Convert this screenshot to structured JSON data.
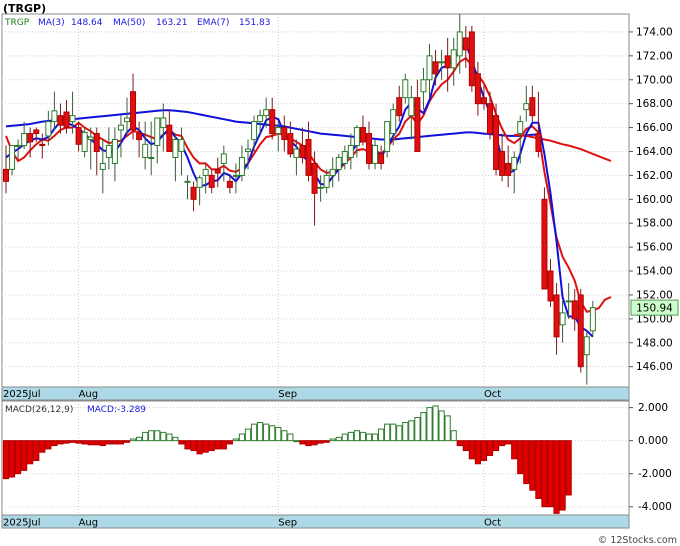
{
  "title": "(TRGP)",
  "legend": {
    "symbol": "TRGP",
    "items": [
      {
        "label": "MA(3)",
        "value": "148.64",
        "color": "#1a1adf"
      },
      {
        "label": "MA(50)",
        "value": "163.21",
        "color": "#1a1adf"
      },
      {
        "label": "EMA(7)",
        "value": "151.83",
        "color": "#1a1adf"
      }
    ]
  },
  "macd_legend": {
    "label": "MACD(26,12,9)",
    "value_label": "MACD:-3.289"
  },
  "last_price_label": "150.94",
  "watermark": "© 12Stocks.com",
  "colors": {
    "up": "#2e7d2e",
    "down": "#e01010",
    "ma_fast": "#1010dd",
    "ma_slow": "#e01010",
    "ema": "#e01010",
    "axis_band": "#add8e6",
    "price_tag": "#ccffcc"
  },
  "chart_data": [
    {
      "type": "candlestick",
      "title": "(TRGP)",
      "x_tick_labels": [
        {
          "label": "2025Jul",
          "index": 0
        },
        {
          "label": "Aug",
          "index": 12
        },
        {
          "label": "Sep",
          "index": 45
        },
        {
          "label": "Oct",
          "index": 79
        }
      ],
      "y_tick_labels": [
        "146.00",
        "148.00",
        "150.00",
        "152.00",
        "154.00",
        "156.00",
        "158.00",
        "160.00",
        "162.00",
        "164.00",
        "166.00",
        "168.00",
        "170.00",
        "172.00",
        "174.00"
      ],
      "ylim": [
        144.3,
        175.5
      ],
      "candles": [
        [
          162.5,
          164.5,
          160.5,
          161.5
        ],
        [
          162.5,
          164.5,
          162.0,
          164.5
        ],
        [
          164.5,
          165.0,
          163.3,
          164.5
        ],
        [
          164.5,
          166.5,
          164.2,
          165.5
        ],
        [
          165.5,
          166.0,
          163.5,
          164.8
        ],
        [
          165.8,
          166.0,
          164.8,
          165.5
        ],
        [
          164.6,
          165.5,
          163.4,
          164.5
        ],
        [
          165.3,
          167.4,
          164.5,
          166.5
        ],
        [
          166.5,
          169.0,
          165.8,
          167.4
        ],
        [
          167.0,
          168.0,
          165.5,
          166.2
        ],
        [
          167.3,
          168.3,
          165.5,
          166.0
        ],
        [
          166.5,
          169.0,
          165.5,
          167.0
        ],
        [
          166.0,
          166.5,
          164.0,
          164.6
        ],
        [
          164.0,
          166.0,
          163.5,
          165.6
        ],
        [
          165.0,
          166.0,
          162.5,
          165.2
        ],
        [
          165.5,
          166.0,
          162.0,
          164.0
        ],
        [
          162.5,
          165.0,
          160.5,
          163.0
        ],
        [
          163.5,
          166.0,
          162.5,
          164.5
        ],
        [
          163.0,
          166.0,
          161.5,
          165.0
        ],
        [
          165.8,
          167.0,
          163.5,
          166.2
        ],
        [
          166.5,
          168.5,
          165.5,
          166.8
        ],
        [
          169.0,
          170.5,
          165.0,
          165.8
        ],
        [
          165.5,
          166.5,
          163.5,
          165.0
        ],
        [
          163.5,
          166.5,
          162.5,
          164.6
        ],
        [
          163.5,
          166.5,
          162.0,
          163.5
        ],
        [
          164.5,
          166.5,
          163.0,
          166.8
        ],
        [
          166.0,
          168.0,
          164.0,
          166.8
        ],
        [
          166.2,
          167.5,
          164.0,
          164.0
        ],
        [
          163.5,
          165.5,
          161.5,
          165.0
        ],
        [
          164.0,
          166.0,
          162.0,
          165.0
        ],
        [
          161.5,
          162.0,
          160.0,
          161.5
        ],
        [
          161.0,
          161.5,
          159.0,
          160.0
        ],
        [
          161.0,
          162.0,
          159.5,
          161.8
        ],
        [
          162.0,
          163.0,
          160.5,
          162.5
        ],
        [
          162.0,
          162.5,
          160.5,
          161.0
        ],
        [
          162.5,
          163.5,
          161.0,
          162.2
        ],
        [
          163.0,
          164.5,
          161.5,
          163.8
        ],
        [
          161.5,
          162.0,
          160.5,
          161.0
        ],
        [
          162.0,
          163.0,
          160.5,
          162.0
        ],
        [
          162.0,
          164.5,
          161.5,
          163.5
        ],
        [
          164.0,
          165.0,
          162.5,
          164.2
        ],
        [
          165.0,
          167.0,
          164.0,
          166.5
        ],
        [
          166.5,
          167.5,
          165.5,
          167.0
        ],
        [
          167.0,
          168.5,
          166.0,
          167.5
        ],
        [
          167.5,
          168.5,
          165.0,
          165.5
        ],
        [
          165.5,
          166.5,
          164.0,
          166.0
        ],
        [
          166.0,
          167.0,
          164.0,
          165.0
        ],
        [
          165.5,
          166.5,
          163.5,
          163.8
        ],
        [
          163.5,
          165.0,
          162.0,
          164.2
        ],
        [
          164.5,
          166.0,
          163.0,
          163.5
        ],
        [
          165.0,
          166.5,
          161.5,
          162.0
        ],
        [
          163.0,
          164.0,
          157.8,
          160.5
        ],
        [
          161.0,
          162.0,
          159.8,
          161.0
        ],
        [
          161.0,
          162.5,
          160.5,
          162.0
        ],
        [
          162.0,
          163.5,
          161.0,
          162.5
        ],
        [
          162.5,
          163.8,
          161.5,
          163.5
        ],
        [
          163.0,
          164.5,
          162.5,
          164.0
        ],
        [
          163.5,
          165.5,
          162.5,
          164.5
        ],
        [
          164.5,
          166.2,
          163.5,
          166.0
        ],
        [
          166.0,
          167.0,
          164.5,
          164.8
        ],
        [
          165.5,
          166.5,
          162.5,
          163.0
        ],
        [
          163.0,
          165.0,
          162.5,
          164.5
        ],
        [
          163.8,
          164.5,
          162.5,
          163.0
        ],
        [
          164.0,
          166.5,
          163.5,
          166.5
        ],
        [
          165.5,
          168.0,
          164.5,
          167.5
        ],
        [
          168.5,
          169.5,
          166.5,
          167.0
        ],
        [
          168.5,
          170.5,
          168.0,
          170.0
        ],
        [
          167.0,
          169.5,
          165.0,
          168.5
        ],
        [
          168.5,
          170.0,
          164.0,
          164.0
        ],
        [
          169.0,
          171.0,
          167.5,
          170.0
        ],
        [
          170.0,
          173.0,
          168.5,
          172.0
        ],
        [
          171.5,
          172.5,
          169.5,
          170.5
        ],
        [
          171.5,
          172.5,
          170.0,
          171.5
        ],
        [
          172.0,
          173.5,
          169.0,
          171.0
        ],
        [
          171.0,
          173.5,
          169.5,
          172.5
        ],
        [
          172.0,
          175.5,
          170.5,
          174.0
        ],
        [
          173.5,
          174.5,
          171.0,
          172.5
        ],
        [
          174.0,
          174.5,
          169.0,
          169.5
        ],
        [
          170.5,
          171.5,
          167.0,
          168.0
        ],
        [
          168.5,
          169.5,
          167.5,
          168.0
        ],
        [
          168.0,
          169.0,
          165.0,
          165.5
        ],
        [
          167.0,
          168.0,
          162.0,
          162.5
        ],
        [
          164.0,
          165.5,
          161.5,
          162.0
        ],
        [
          163.0,
          164.5,
          161.0,
          162.0
        ],
        [
          162.5,
          164.0,
          160.5,
          163.5
        ],
        [
          165.5,
          167.0,
          163.0,
          166.5
        ],
        [
          167.5,
          169.5,
          166.5,
          168.0
        ],
        [
          168.5,
          169.5,
          166.5,
          167.0
        ],
        [
          165.5,
          169.0,
          163.5,
          164.0
        ],
        [
          160.0,
          161.0,
          152.5,
          152.5
        ],
        [
          154.0,
          155.0,
          151.0,
          151.5
        ],
        [
          152.0,
          153.0,
          147.0,
          148.5
        ],
        [
          149.5,
          151.5,
          148.0,
          150.5
        ],
        [
          151.5,
          153.0,
          150.0,
          151.5
        ],
        [
          151.5,
          152.5,
          149.0,
          150.0
        ],
        [
          152.0,
          152.5,
          145.5,
          146.0
        ],
        [
          147.0,
          149.0,
          144.5,
          148.5
        ],
        [
          149.0,
          151.5,
          148.5,
          150.94
        ]
      ],
      "series": [
        {
          "name": "MA(3)",
          "color": "#1010dd",
          "values": [
            163.5,
            163.9,
            164.2,
            164.6,
            164.9,
            165.1,
            165.0,
            165.2,
            165.9,
            166.5,
            166.4,
            166.2,
            165.9,
            165.5,
            165.0,
            164.6,
            164.1,
            164.0,
            164.0,
            164.7,
            165.6,
            166.1,
            165.8,
            165.1,
            164.6,
            164.8,
            165.4,
            165.9,
            165.2,
            164.6,
            163.5,
            162.2,
            161.1,
            161.2,
            161.5,
            161.6,
            162.2,
            162.0,
            161.5,
            162.2,
            163.0,
            164.4,
            165.5,
            166.6,
            166.9,
            166.7,
            165.5,
            164.9,
            164.4,
            163.6,
            163.2,
            162.1,
            161.3,
            161.2,
            161.9,
            162.5,
            163.2,
            163.9,
            164.6,
            165.0,
            164.8,
            164.2,
            163.6,
            164.3,
            165.3,
            166.1,
            167.5,
            168.1,
            167.6,
            167.2,
            168.3,
            170.2,
            171.0,
            171.2,
            171.7,
            172.5,
            173.0,
            171.7,
            170.0,
            168.5,
            167.2,
            165.3,
            163.3,
            162.2,
            162.4,
            163.8,
            165.5,
            166.4,
            166.4,
            163.8,
            160.5,
            156.5,
            151.8,
            150.2,
            150.2,
            149.3,
            149.0,
            148.5
          ]
        },
        {
          "name": "MA(50)",
          "color": "#1010dd",
          "values": [
            166.1,
            166.15,
            166.2,
            166.25,
            166.3,
            166.4,
            166.5,
            166.55,
            166.6,
            166.65,
            166.7,
            166.7,
            166.75,
            166.8,
            166.85,
            166.9,
            166.95,
            167.0,
            167.05,
            167.1,
            167.15,
            167.2,
            167.25,
            167.3,
            167.35,
            167.4,
            167.45,
            167.45,
            167.4,
            167.35,
            167.3,
            167.2,
            167.1,
            167.0,
            166.9,
            166.8,
            166.7,
            166.6,
            166.5,
            166.45,
            166.4,
            166.35,
            166.3,
            166.25,
            166.2,
            166.15,
            166.1,
            166.0,
            165.9,
            165.8,
            165.7,
            165.6,
            165.5,
            165.45,
            165.4,
            165.35,
            165.3,
            165.25,
            165.2,
            165.15,
            165.1,
            165.05,
            165.0,
            165.0,
            165.0,
            165.05,
            165.1,
            165.15,
            165.2,
            165.25,
            165.3,
            165.35,
            165.4,
            165.45,
            165.5,
            165.55,
            165.6,
            165.6,
            165.55,
            165.5,
            165.45,
            165.4,
            165.35,
            165.3,
            165.3,
            165.3,
            165.35,
            165.4,
            165.4
          ]
        },
        {
          "name": "EMA(7)",
          "color": "#e01010",
          "values": [
            165.3,
            164.0,
            163.2,
            163.5,
            164.1,
            164.6,
            165.0,
            164.9,
            165.3,
            165.8,
            166.0,
            166.0,
            166.4,
            166.0,
            165.7,
            165.3,
            165.0,
            164.7,
            164.8,
            164.9,
            165.3,
            165.7,
            165.6,
            165.4,
            165.2,
            165.0,
            165.4,
            165.8,
            165.4,
            165.3,
            164.3,
            163.5,
            163.0,
            163.0,
            162.5,
            162.5,
            162.8,
            162.4,
            162.3,
            162.6,
            163.0,
            163.8,
            164.6,
            165.2,
            165.3,
            165.5,
            165.4,
            165.1,
            164.8,
            164.5,
            163.9,
            163.1,
            162.5,
            162.2,
            162.3,
            162.5,
            163.0,
            163.5,
            164.1,
            164.2,
            164.0,
            164.1,
            163.8,
            164.3,
            165.0,
            165.5,
            166.5,
            167.0,
            166.3,
            167.0,
            168.2,
            169.0,
            169.6,
            170.0,
            170.7,
            171.5,
            171.8,
            171.2,
            170.4,
            169.7,
            168.6,
            167.1,
            165.9,
            165.0,
            164.7,
            165.1,
            165.9,
            166.1,
            165.6,
            162.3,
            159.6,
            156.8,
            155.2,
            154.3,
            153.2,
            151.4,
            150.6,
            150.7,
            150.9,
            151.6,
            151.83
          ]
        },
        {
          "name": "MA(50) extension",
          "color": "#e01010",
          "values": [
            165.4,
            165.35,
            165.3,
            165.2,
            165.1,
            165.0,
            164.9,
            164.75,
            164.6,
            164.5,
            164.35,
            164.2,
            164.0,
            163.8,
            163.6,
            163.4,
            163.21
          ]
        }
      ]
    },
    {
      "type": "bar",
      "title": "MACD(26,12,9)",
      "value_label": "MACD:-3.289",
      "y_tick_labels": [
        "-4.000",
        "-2.000",
        "0.000",
        "2.000"
      ],
      "ylim": [
        -4.5,
        2.4
      ],
      "values": [
        -2.3,
        -2.2,
        -2.0,
        -1.8,
        -1.4,
        -1.2,
        -0.7,
        -0.5,
        -0.3,
        -0.2,
        -0.15,
        -0.1,
        -0.15,
        -0.2,
        -0.25,
        -0.25,
        -0.3,
        -0.2,
        -0.2,
        -0.2,
        -0.1,
        0.1,
        0.2,
        0.5,
        0.6,
        0.6,
        0.5,
        0.4,
        0.2,
        -0.2,
        -0.5,
        -0.6,
        -0.8,
        -0.7,
        -0.6,
        -0.5,
        -0.5,
        -0.2,
        0.1,
        0.4,
        0.7,
        1.0,
        1.1,
        1.0,
        0.9,
        0.8,
        0.6,
        0.4,
        0.0,
        -0.2,
        -0.3,
        -0.25,
        -0.15,
        -0.1,
        0.1,
        0.2,
        0.4,
        0.5,
        0.6,
        0.5,
        0.4,
        0.4,
        0.7,
        1.0,
        1.0,
        0.9,
        1.1,
        1.2,
        1.4,
        1.7,
        2.0,
        2.1,
        1.8,
        1.5,
        0.6,
        -0.3,
        -0.6,
        -1.1,
        -1.4,
        -1.2,
        -0.9,
        -0.6,
        -0.3,
        -0.2,
        -1.1,
        -2.0,
        -2.6,
        -3.0,
        -3.5,
        -4.0,
        -4.0,
        -4.4,
        -4.2,
        -3.289
      ]
    }
  ]
}
